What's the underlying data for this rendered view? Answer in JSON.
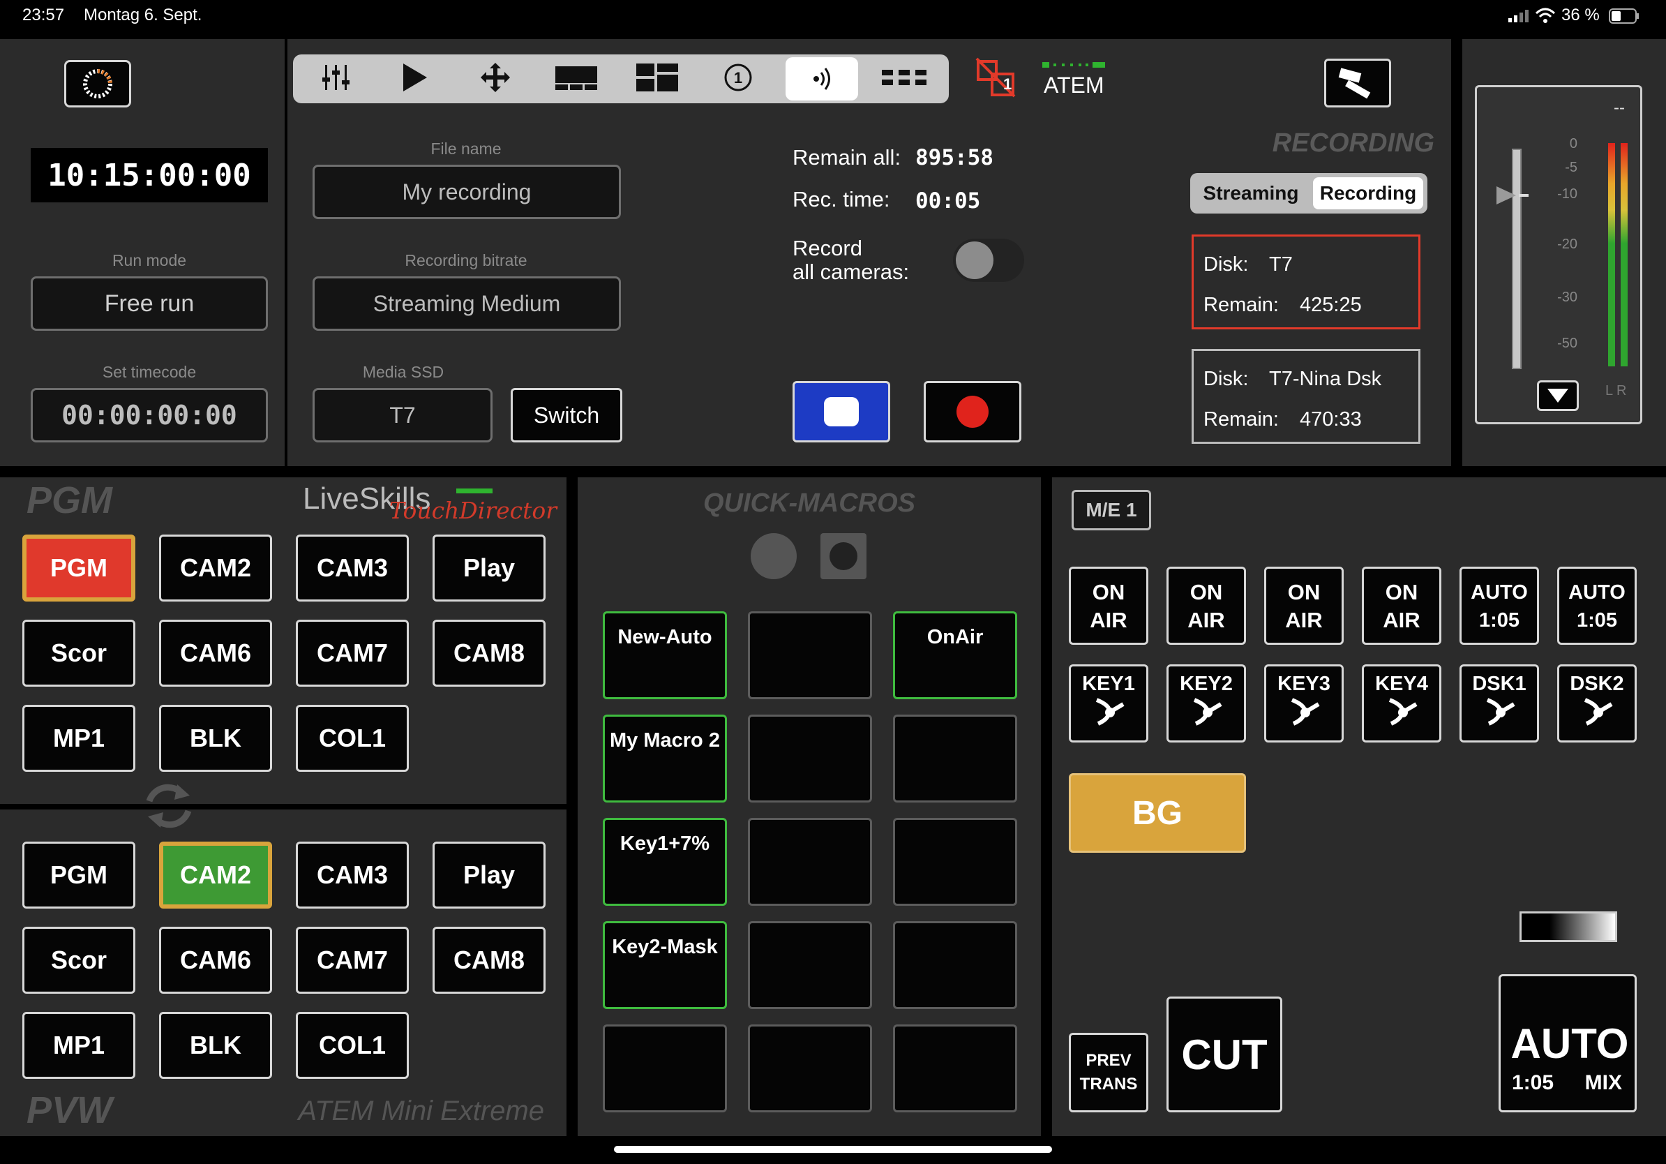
{
  "status_bar": {
    "time": "23:57",
    "date": "Montag 6. Sept.",
    "battery": "36 %"
  },
  "toolbar": {
    "icons": [
      "mixer-sliders-icon",
      "play-icon",
      "move-arrows-icon",
      "multiview-icon",
      "layout-grid-icon",
      "number-one-icon",
      "stream-broadcast-icon",
      "more-dots-icon"
    ],
    "active": "stream-broadcast-icon",
    "switcher_badge": "1",
    "switcher_name": "ATEM"
  },
  "timecode": {
    "current": "10:15:00:00",
    "run_mode_label": "Run mode",
    "run_mode": "Free run",
    "set_label": "Set timecode",
    "set_value": "00:00:00:00"
  },
  "recording_form": {
    "file_name_label": "File name",
    "file_name": "My recording",
    "bitrate_label": "Recording bitrate",
    "bitrate": "Streaming Medium",
    "media_label": "Media SSD",
    "media": "T7",
    "switch_label": "Switch"
  },
  "recording_status": {
    "remain_all_label": "Remain all:",
    "remain_all": "895:58",
    "rec_time_label": "Rec. time:",
    "rec_time": "00:05",
    "record_all_label_1": "Record",
    "record_all_label_2": "all cameras:",
    "record_all_on": false
  },
  "recording_panel": {
    "title": "RECORDING",
    "tab_streaming": "Streaming",
    "tab_recording": "Recording",
    "active_tab": "Recording",
    "disk_label": "Disk:",
    "remain_label": "Remain:",
    "disk1_name": "T7",
    "disk1_remain": "425:25",
    "disk2_name": "T7-Nina Dsk",
    "disk2_remain": "470:33",
    "colors": {
      "active_disk_border": "#e23a2a",
      "inactive_disk_border": "#bbbbbb"
    }
  },
  "audio_meter": {
    "value": "--",
    "scale": [
      "0",
      "-5",
      "-10",
      "-20",
      "-30",
      "-50"
    ],
    "channels": "L R"
  },
  "pgm": {
    "title": "PGM",
    "brand": "LiveSkills",
    "brand_script": "TouchDirector",
    "buttons": [
      "PGM",
      "CAM2",
      "CAM3",
      "Play",
      "Scor",
      "CAM6",
      "CAM7",
      "CAM8",
      "MP1",
      "BLK",
      "COL1"
    ],
    "active": "PGM",
    "active_color": "#e0392c"
  },
  "pvw": {
    "title": "PVW",
    "device": "ATEM Mini Extreme",
    "buttons": [
      "PGM",
      "CAM2",
      "CAM3",
      "Play",
      "Scor",
      "CAM6",
      "CAM7",
      "CAM8",
      "MP1",
      "BLK",
      "COL1"
    ],
    "active": "CAM2",
    "active_color": "#3e9a34"
  },
  "macros": {
    "title": "QUICK-MACROS",
    "grid": [
      "New-Auto",
      "",
      "OnAir",
      "My Macro 2",
      "",
      "",
      "Key1+7%",
      "",
      "",
      "Key2-Mask",
      "",
      "",
      "",
      "",
      ""
    ],
    "active_border": "#3fbb3f"
  },
  "me": {
    "title": "M/E 1",
    "onair_labels": [
      "ON",
      "AIR"
    ],
    "onair_count": 4,
    "auto_labels": [
      "AUTO",
      "1:05"
    ],
    "keys": [
      "KEY1",
      "KEY2",
      "KEY3",
      "KEY4",
      "DSK1",
      "DSK2"
    ],
    "bg_label": "BG",
    "bg_color": "#d9a43c",
    "prev_trans_1": "PREV",
    "prev_trans_2": "TRANS",
    "cut_label": "CUT",
    "auto_label": "AUTO",
    "auto_rate": "1:05",
    "auto_type": "MIX"
  }
}
